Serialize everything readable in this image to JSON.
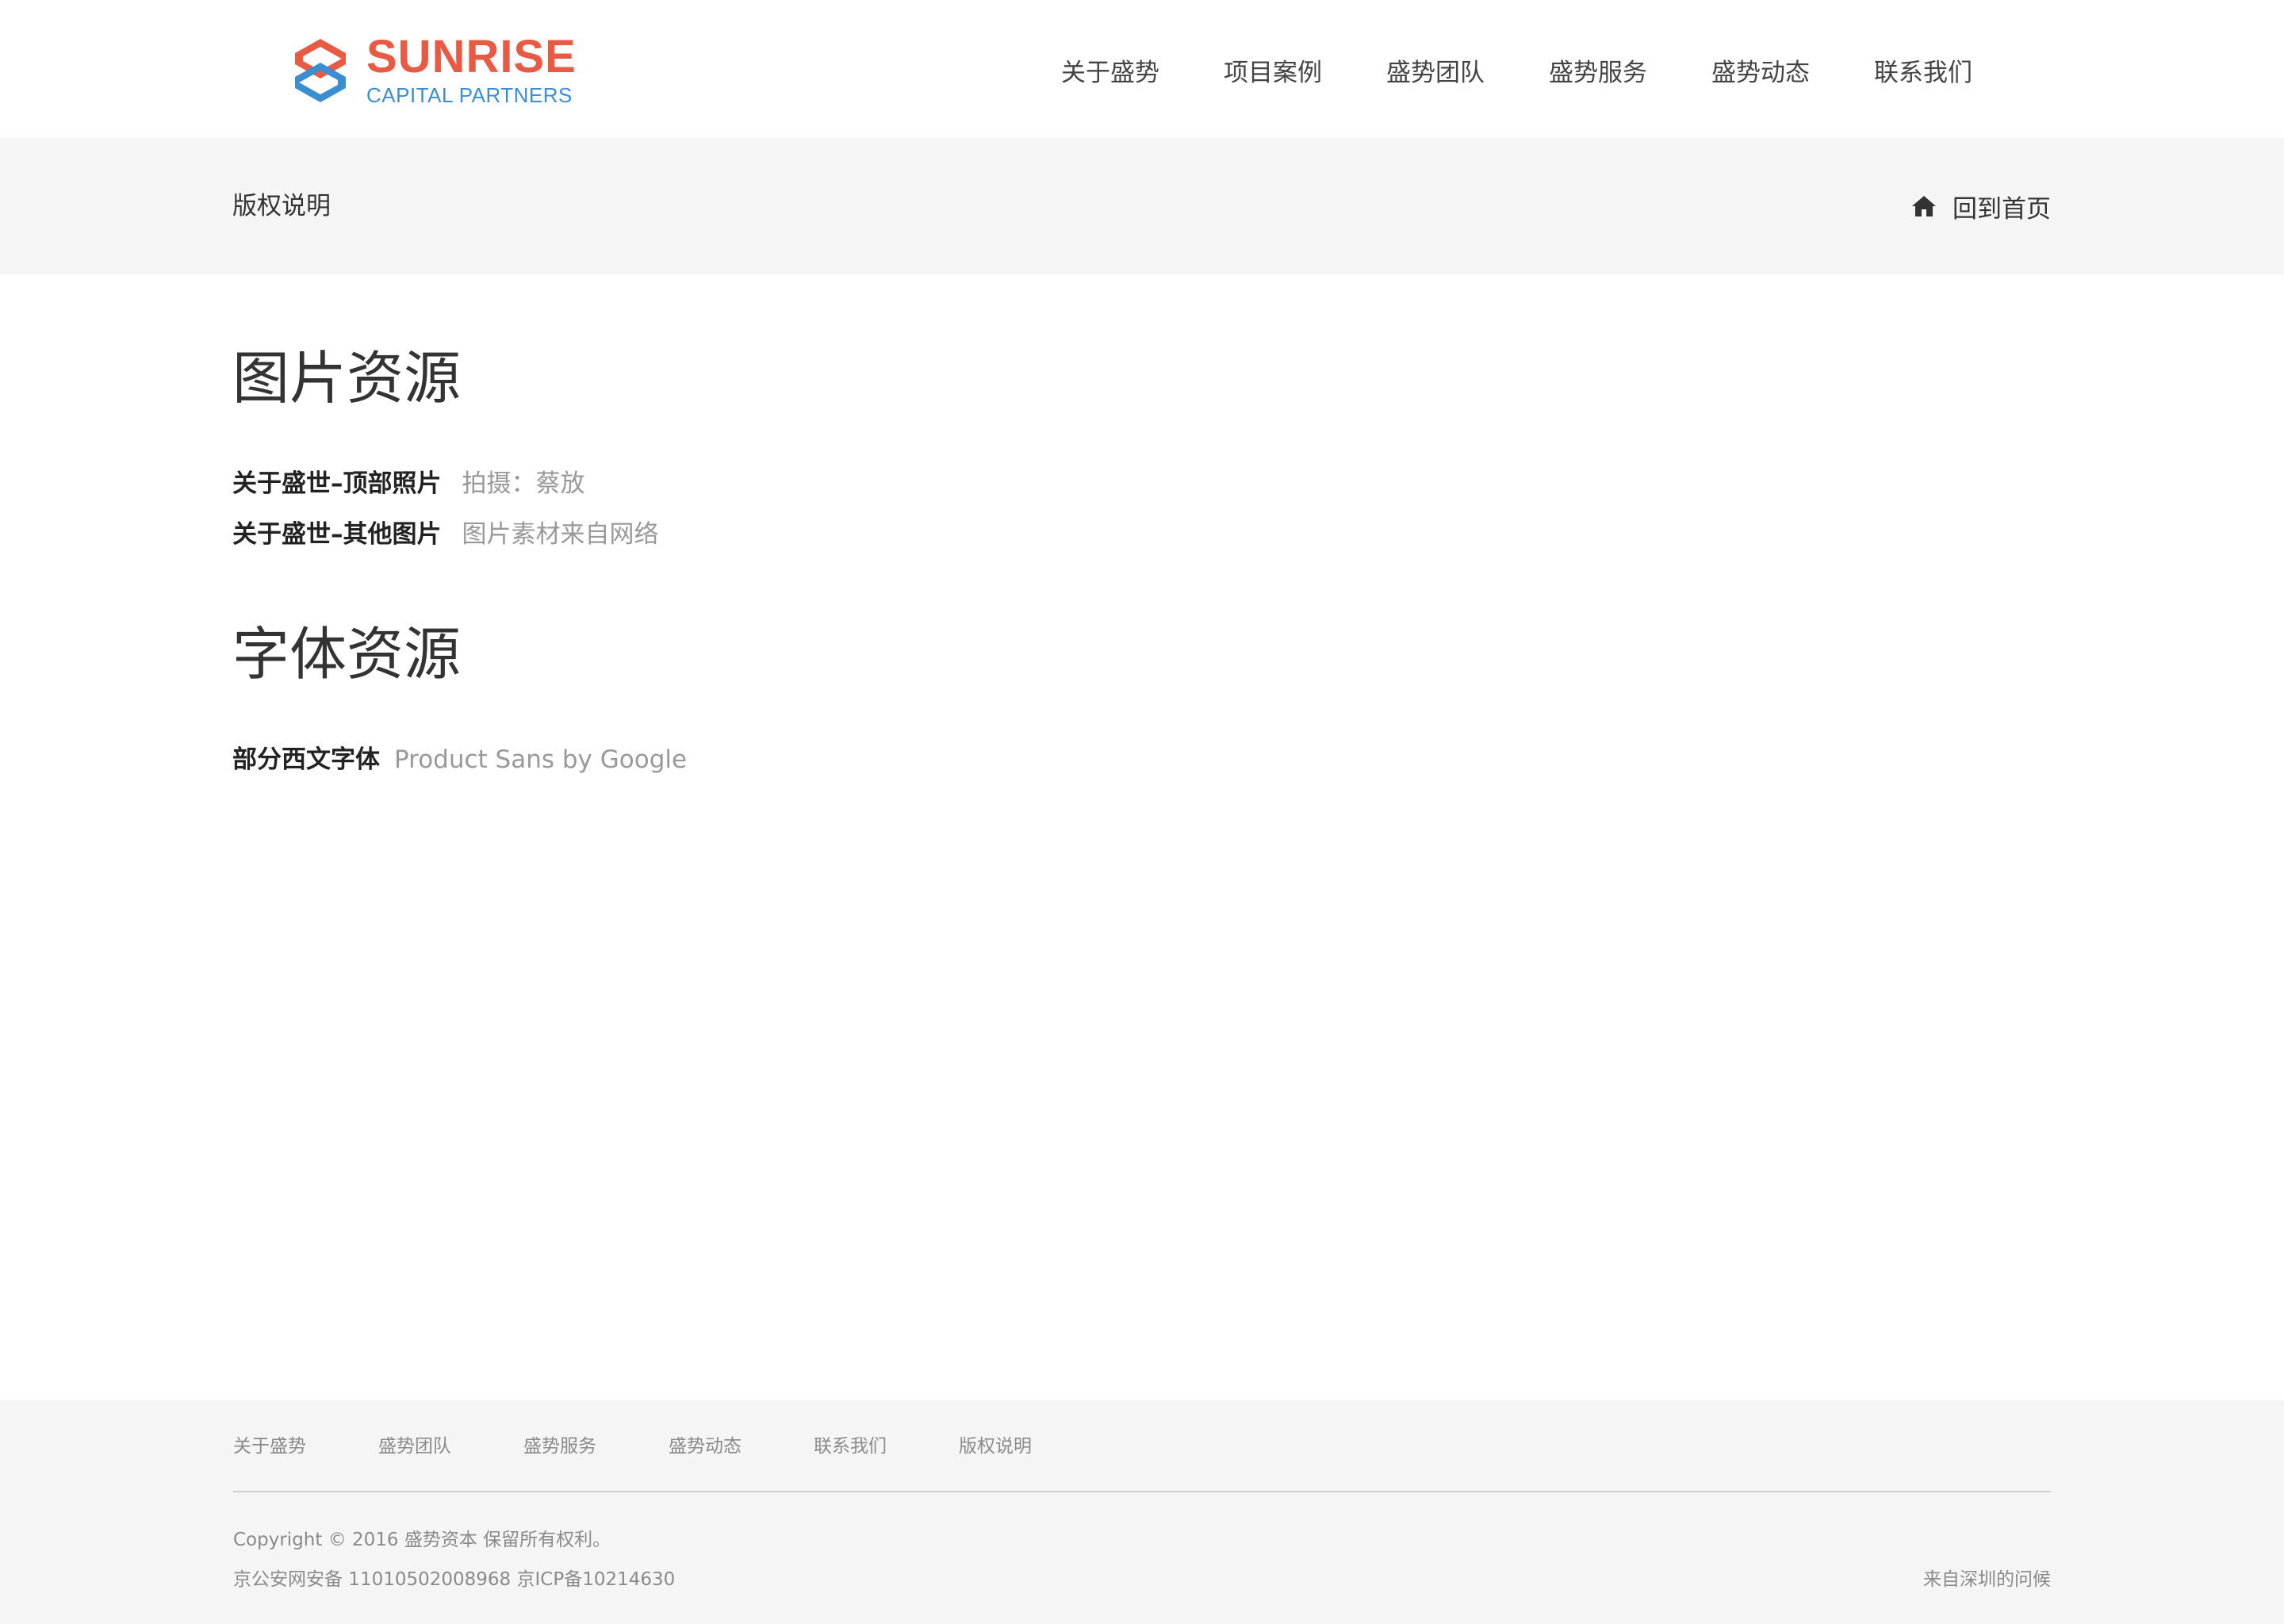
{
  "brand": {
    "name": "SUNRISE",
    "subtitle": "CAPITAL PARTNERS",
    "primary_color": "#e85a44",
    "secondary_color": "#3b8fd0"
  },
  "nav": {
    "items": [
      {
        "label": "关于盛势"
      },
      {
        "label": "项目案例"
      },
      {
        "label": "盛势团队"
      },
      {
        "label": "盛势服务"
      },
      {
        "label": "盛势动态"
      },
      {
        "label": "联系我们"
      }
    ]
  },
  "crumb": {
    "title": "版权说明",
    "home_icon": "home-icon",
    "home_label": "回到首页"
  },
  "sections": [
    {
      "title": "图片资源",
      "credits": [
        {
          "label": "关于盛世–顶部照片",
          "value": "拍摄：蔡放"
        },
        {
          "label": "关于盛世–其他图片",
          "value": "图片素材来自网络"
        }
      ]
    },
    {
      "title": "字体资源",
      "credits": [
        {
          "label": "部分西文字体",
          "value": "Product Sans by Google"
        }
      ]
    }
  ],
  "footer": {
    "links": [
      {
        "label": "关于盛势"
      },
      {
        "label": "盛势团队"
      },
      {
        "label": "盛势服务"
      },
      {
        "label": "盛势动态"
      },
      {
        "label": "联系我们"
      },
      {
        "label": "版权说明"
      }
    ],
    "copyright": "Copyright © 2016 盛势资本 保留所有权利。",
    "icp": "京公安网安备 11010502008968 京ICP备10214630",
    "greeting": "来自深圳的问候"
  }
}
